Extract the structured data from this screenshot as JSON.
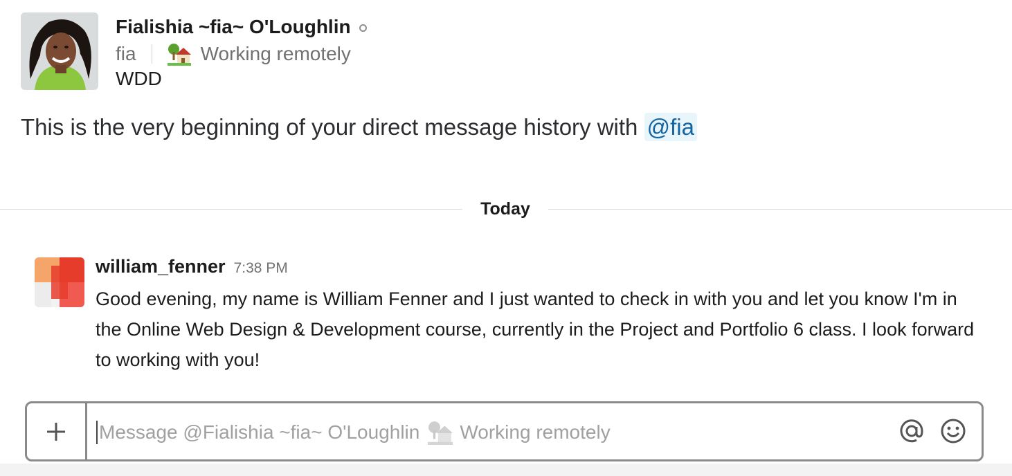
{
  "profile": {
    "name": "Fialishia ~fia~ O'Loughlin",
    "handle": "fia",
    "status_emoji": "house-with-garden-icon",
    "status_text": "Working remotely",
    "title": "WDD"
  },
  "intro": {
    "text": "This is the very beginning of your direct message history with ",
    "mention": "@fia"
  },
  "divider": {
    "label": "Today"
  },
  "messages": [
    {
      "author": "william_fenner",
      "time": "7:38 PM",
      "text": "Good evening, my name is William Fenner and I just wanted to check in with you and let you know I'm in the Online Web Design & Development course, currently in the Project and Portfolio 6 class. I look forward to working with you!"
    }
  ],
  "composer": {
    "placeholder_prefix": "Message @Fialishia ~fia~ O'Loughlin",
    "placeholder_status": "Working remotely",
    "add_icon": "plus-icon",
    "mention_icon": "at-sign-icon",
    "emoji_icon": "smiley-icon"
  },
  "colors": {
    "mention_text": "#1264a3",
    "mention_bg": "#e8f5fa",
    "composer_border": "#8a8a8a"
  }
}
